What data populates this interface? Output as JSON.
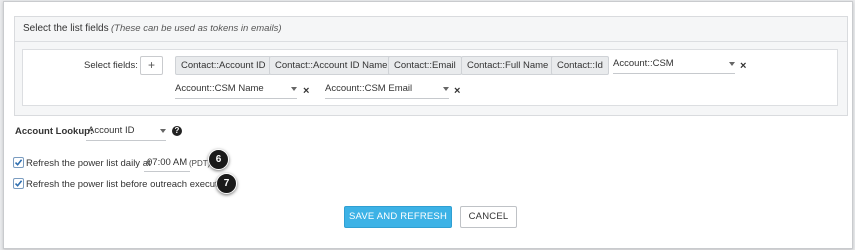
{
  "list_fields": {
    "title": "Select the list fields",
    "note": "(These can be used as tokens in emails)",
    "select_label": "Select fields:",
    "add_button": "+",
    "tokens": [
      "Contact::Account ID",
      "Contact::Account ID Name",
      "Contact::Email",
      "Contact::Full Name",
      "Contact::Id"
    ],
    "dropdowns": [
      {
        "value": "Account::CSM",
        "remove": "×"
      },
      {
        "value": "Account::CSM Name",
        "remove": "×"
      },
      {
        "value": "Account::CSM Email",
        "remove": "×"
      }
    ]
  },
  "account_lookup": {
    "label": "Account Lookup:",
    "value": "Account ID",
    "help": "?"
  },
  "refresh_daily": {
    "checked": true,
    "label": "Refresh the power list daily at",
    "time": "07:00 AM",
    "timezone": "(PDT)"
  },
  "refresh_before": {
    "checked": true,
    "label": "Refresh the power list before outreach execution"
  },
  "markers": [
    "6",
    "7"
  ],
  "buttons": {
    "primary": "SAVE AND REFRESH",
    "secondary": "CANCEL"
  },
  "colors": {
    "primary_button": "#3cb2e6",
    "marker": "#1a1a1a",
    "checkbox_check": "#2f6fb0"
  }
}
